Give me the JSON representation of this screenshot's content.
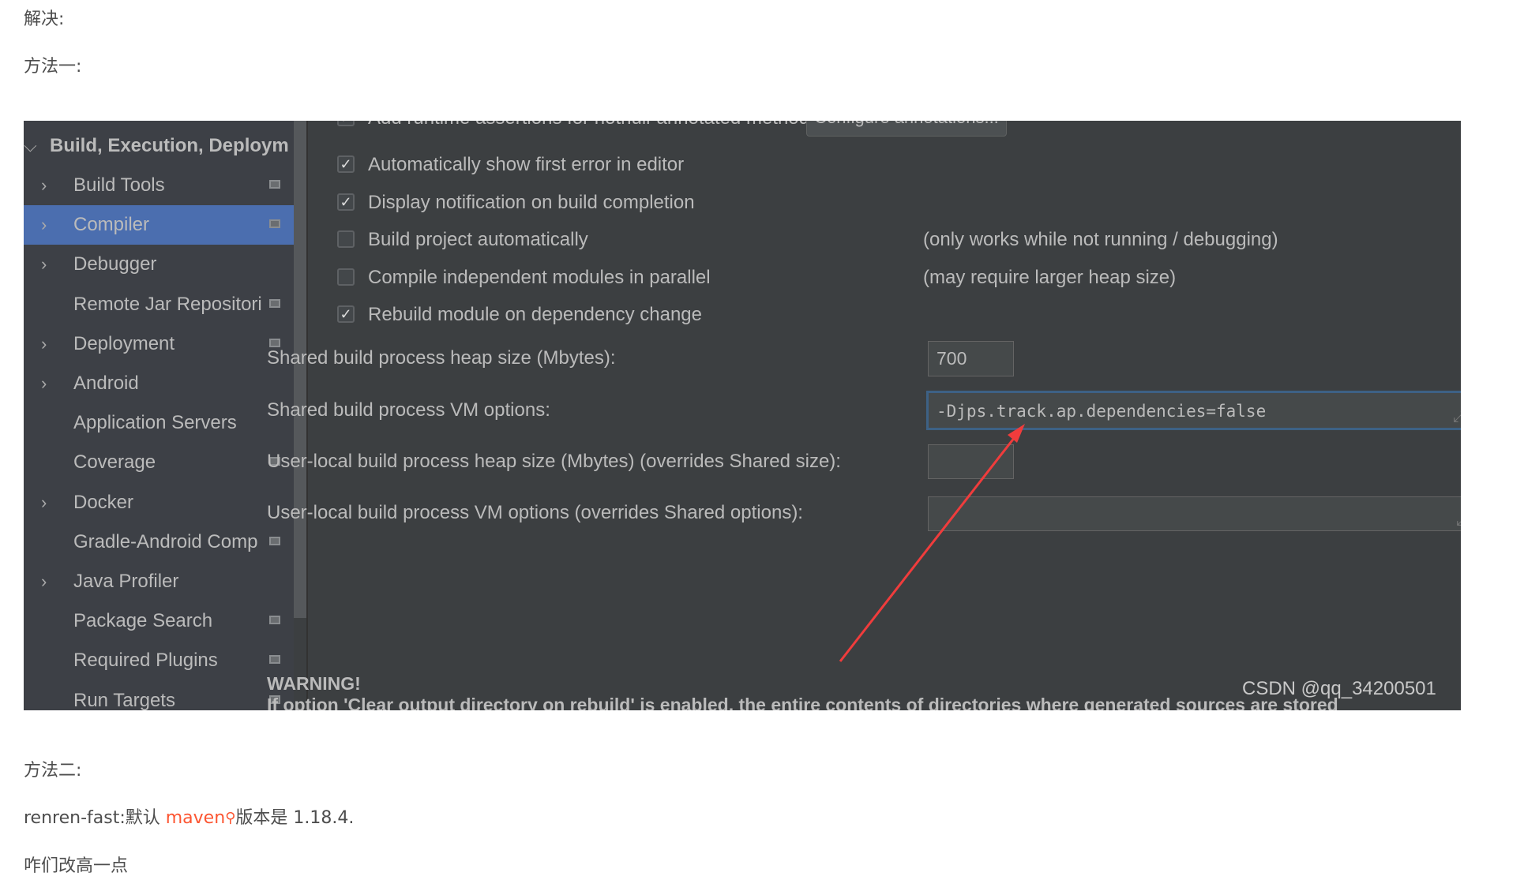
{
  "article": {
    "p1": "解决:",
    "p2": "方法一:",
    "p3": "方法二:",
    "p4_prefix": "renren-fast:默认 ",
    "p4_link": "maven",
    "p4_suffix": "版本是 1.18.4.",
    "p5": "咋们改高一点",
    "link_color": "#fc5531"
  },
  "sidebar": {
    "header": "Build, Execution, Deploym",
    "items": [
      {
        "label": "Build Tools",
        "chevron": true,
        "config_icon": true
      },
      {
        "label": "Compiler",
        "chevron": true,
        "config_icon": true,
        "selected": true
      },
      {
        "label": "Debugger",
        "chevron": true,
        "config_icon": false
      },
      {
        "label": "Remote Jar Repositori",
        "chevron": false,
        "config_icon": true
      },
      {
        "label": "Deployment",
        "chevron": true,
        "config_icon": true
      },
      {
        "label": "Android",
        "chevron": true,
        "config_icon": false
      },
      {
        "label": "Application Servers",
        "chevron": false,
        "config_icon": false
      },
      {
        "label": "Coverage",
        "chevron": false,
        "config_icon": true
      },
      {
        "label": "Docker",
        "chevron": true,
        "config_icon": false
      },
      {
        "label": "Gradle-Android Comp",
        "chevron": false,
        "config_icon": true
      },
      {
        "label": "Java Profiler",
        "chevron": true,
        "config_icon": false
      },
      {
        "label": "Package Search",
        "chevron": false,
        "config_icon": true
      },
      {
        "label": "Required Plugins",
        "chevron": false,
        "config_icon": true
      },
      {
        "label": "Run Targets",
        "chevron": false,
        "config_icon": true
      }
    ]
  },
  "compiler": {
    "top_option": "Add runtime assertions for notnull-annotated methods and parameters",
    "configure_button": "Configure annotations...",
    "options": [
      {
        "label": "Automatically show first error in editor",
        "checked": true,
        "note": ""
      },
      {
        "label": "Display notification on build completion",
        "checked": true,
        "note": ""
      },
      {
        "label": "Build project automatically",
        "checked": false,
        "note": "(only works while not running / debugging)"
      },
      {
        "label": "Compile independent modules in parallel",
        "checked": false,
        "note": "(may require larger heap size)"
      },
      {
        "label": "Rebuild module on dependency change",
        "checked": true,
        "note": ""
      }
    ],
    "shared_heap_label": "Shared build process heap size (Mbytes):",
    "shared_heap_value": "700",
    "shared_vm_label": "Shared build process VM options:",
    "shared_vm_value": "-Djps.track.ap.dependencies=false",
    "user_heap_label": "User-local build process heap size (Mbytes) (overrides Shared size):",
    "user_heap_value": "",
    "user_vm_label": "User-local build process VM options (overrides Shared options):",
    "user_vm_value": "",
    "warning_title": "WARNING!",
    "warning_text": "If option 'Clear output directory on rebuild' is enabled, the entire contents of directories where generated sources are stored",
    "watermark": "CSDN @qq_34200501",
    "arrow_color": "#f03c3c"
  }
}
